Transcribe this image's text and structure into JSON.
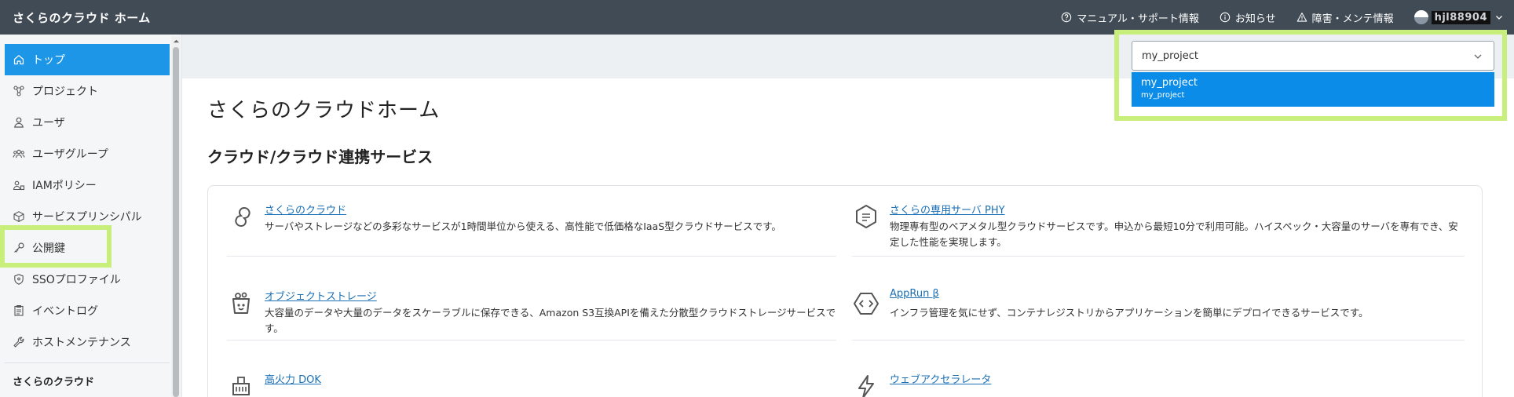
{
  "header": {
    "brand": "さくらのクラウド ホーム",
    "links": [
      {
        "label": "マニュアル・サポート情報",
        "icon": "help-circle-icon"
      },
      {
        "label": "お知らせ",
        "icon": "info-circle-icon"
      },
      {
        "label": "障害・メンテ情報",
        "icon": "warning-triangle-icon"
      }
    ],
    "account_id": "hjl88904"
  },
  "sidebar": {
    "items": [
      {
        "label": "トップ",
        "icon": "home-icon",
        "active": true
      },
      {
        "label": "プロジェクト",
        "icon": "project-icon"
      },
      {
        "label": "ユーザ",
        "icon": "user-icon"
      },
      {
        "label": "ユーザグループ",
        "icon": "user-group-icon"
      },
      {
        "label": "IAMポリシー",
        "icon": "iam-policy-icon"
      },
      {
        "label": "サービスプリンシパル",
        "icon": "cube-icon"
      },
      {
        "label": "公開鍵",
        "icon": "key-icon"
      },
      {
        "label": "SSOプロファイル",
        "icon": "shield-icon"
      },
      {
        "label": "イベントログ",
        "icon": "log-icon"
      },
      {
        "label": "ホストメンテナンス",
        "icon": "wrench-icon"
      }
    ],
    "section_label": "さくらのクラウド"
  },
  "project_selector": {
    "value": "my_project",
    "options": [
      {
        "name": "my_project",
        "sub": "my_project"
      }
    ]
  },
  "main": {
    "title": "さくらのクラウドホーム",
    "section_title": "クラウド/クラウド連携サービス",
    "services": [
      {
        "title": "さくらのクラウド",
        "icon": "sakura-cloud-icon",
        "desc": "サーバやストレージなどの多彩なサービスが1時間単位から使える、高性能で低価格なIaaS型クラウドサービスです。"
      },
      {
        "title": "さくらの専用サーバ PHY",
        "icon": "dedicated-server-icon",
        "desc": "物理専有型のベアメタル型クラウドサービスです。申込から最短10分で利用可能。ハイスペック・大容量のサーバを専有でき、安定した性能を実現します。"
      },
      {
        "title": "オブジェクトストレージ",
        "icon": "object-storage-icon",
        "desc": "大容量のデータや大量のデータをスケーラブルに保存できる、Amazon S3互換APIを備えた分散型クラウドストレージサービスです。"
      },
      {
        "title": "AppRun β",
        "icon": "apprun-icon",
        "desc": "インフラ管理を気にせず、コンテナレジストリからアプリケーションを簡単にデプロイできるサービスです。"
      },
      {
        "title": "高火力 DOK",
        "icon": "dok-icon",
        "desc": ""
      },
      {
        "title": "ウェブアクセラレータ",
        "icon": "web-accelerator-icon",
        "desc": ""
      }
    ]
  },
  "colors": {
    "header_bg": "#414b55",
    "active_item": "#1e96e8",
    "dropdown_selected": "#0a8ce8",
    "highlight": "#c8ee7c",
    "link": "#1a6fb5"
  }
}
